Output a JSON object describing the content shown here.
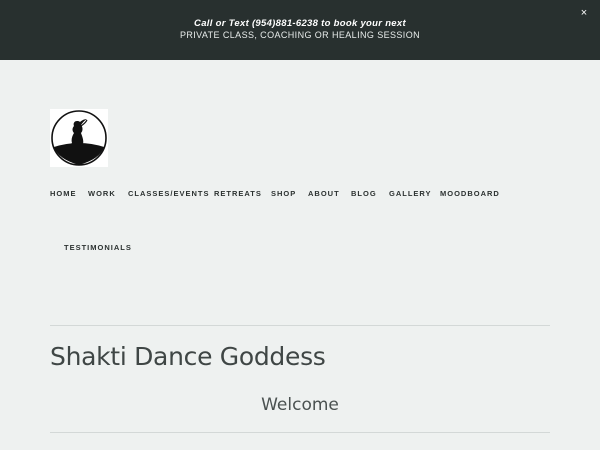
{
  "announcement": {
    "line1": "Call or Text (954)881-6238 to book your next",
    "line2": "PRIVATE CLASS, COACHING OR HEALING SESSION",
    "close_label": "×"
  },
  "logo": {
    "icon": "dancer-silhouette-logo"
  },
  "nav": {
    "items": [
      {
        "label": "HOME"
      },
      {
        "label": "WORK"
      },
      {
        "label": "CLASSES/EVENTS"
      },
      {
        "label": "RETREATS"
      },
      {
        "label": "SHOP"
      },
      {
        "label": "ABOUT"
      },
      {
        "label": "BLOG"
      },
      {
        "label": "GALLERY"
      },
      {
        "label": "MOODBOARD"
      },
      {
        "label": "TESTIMONIALS"
      }
    ]
  },
  "site": {
    "title": "Shakti Dance Goddess",
    "subtitle": "Welcome"
  },
  "colors": {
    "announcement_bg": "#28302f",
    "page_bg": "#eef1f0",
    "text": "#2c3231"
  }
}
